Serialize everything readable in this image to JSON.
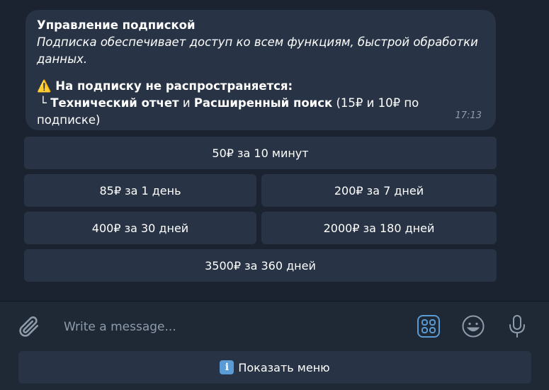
{
  "message": {
    "title": "Управление подпиской",
    "description": "Подписка обеспечивает доступ ко всем функциям, быстрой обработки данных.",
    "warning_icon": "⚠️",
    "warning_text": "На подписку не распространяется:",
    "tree_glyph": "└",
    "item1": "Технический отчет",
    "conj": "и",
    "item2": "Расширенный поиск",
    "note": "(15₽  и 10₽ по подписке)",
    "time": "17:13"
  },
  "keyboard": {
    "b1": "50₽ за 10 минут",
    "b2": "85₽ за 1 день",
    "b3": "200₽ за 7 дней",
    "b4": "400₽ за 30 дней",
    "b5": "2000₽ за 180 дней",
    "b6": "3500₽ за 360 дней"
  },
  "composer": {
    "placeholder": "Write a message...",
    "menu_icon_glyph": "i",
    "menu_label": "Показать меню"
  },
  "icons": {
    "attach": "paperclip-icon",
    "bot_keyboard": "keyboard-grid-icon",
    "emoji": "smiley-icon",
    "voice": "microphone-icon"
  },
  "colors": {
    "background": "#1b2330",
    "bubble": "#283445",
    "accent": "#5b9bd5",
    "muted": "#8e9bab"
  }
}
